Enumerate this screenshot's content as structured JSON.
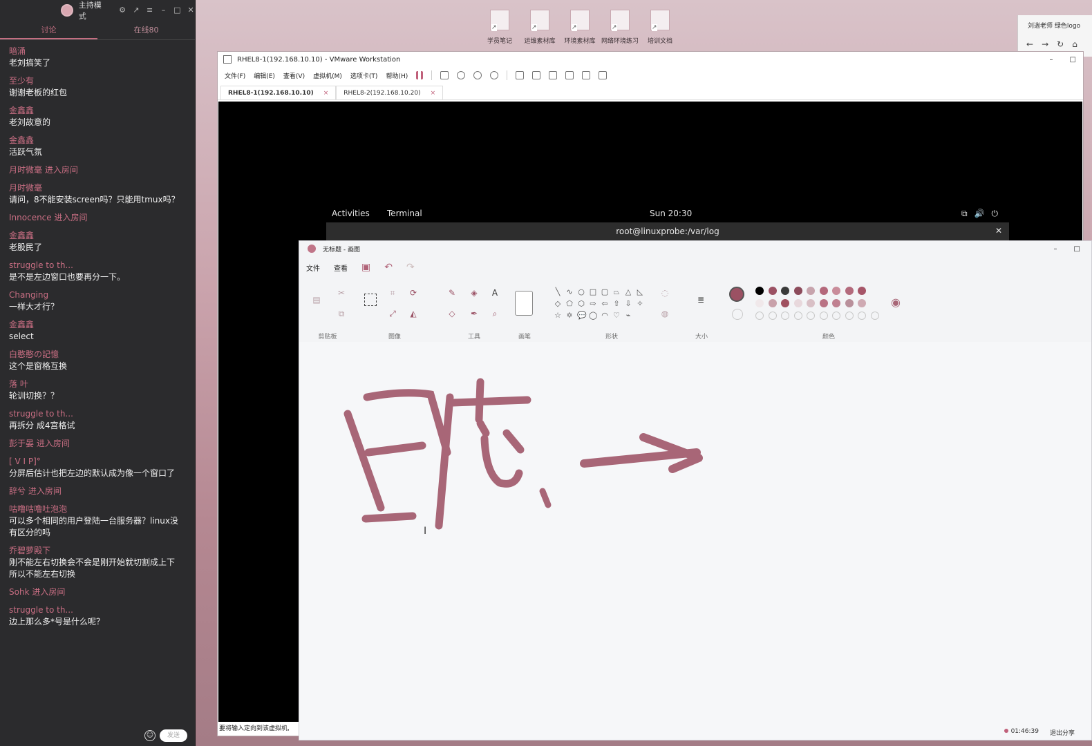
{
  "chat": {
    "mode_label": "主持模式",
    "tabs": [
      "讨论",
      "在线80"
    ],
    "messages": [
      {
        "name": "暗涌",
        "text": "老刘搞笑了"
      },
      {
        "name": "至少有",
        "text": "谢谢老板的红包"
      },
      {
        "name": "金鑫鑫",
        "text": "老刘故意的"
      },
      {
        "name": "金鑫鑫",
        "text": "活跃气氛"
      },
      {
        "name": "月时微毫 进入房间",
        "text": ""
      },
      {
        "name": "月时微毫",
        "text": "请问，8不能安装screen吗？只能用tmux吗？"
      },
      {
        "name": "Innocence 进入房间",
        "text": ""
      },
      {
        "name": "金鑫鑫",
        "text": "老股民了"
      },
      {
        "name": "struggle to th...",
        "text": "是不是左边窗口也要再分一下。"
      },
      {
        "name": "Changing",
        "text": "一样大才行？"
      },
      {
        "name": "金鑫鑫",
        "text": "select"
      },
      {
        "name": "白憨憨の記憶",
        "text": "这个是窗格互换"
      },
      {
        "name": "落  叶",
        "text": "轮训切换？？"
      },
      {
        "name": "struggle to th...",
        "text": "再拆分 成4宫格试"
      },
      {
        "name": "彭于晏 进入房间",
        "text": ""
      },
      {
        "name": "[  V  I  P]°",
        "text": "分屏后估计也把左边的默认成为像一个窗口了"
      },
      {
        "name": "辞兮 进入房间",
        "text": ""
      },
      {
        "name": "咕噜咕噜吐泡泡",
        "text": "可以多个相同的用户登陆一台服务器？linux没有区分的吗"
      },
      {
        "name": "乔碧萝殿下",
        "text": "刚不能左右切换会不会是刚开始就切割成上下 所以不能左右切换"
      },
      {
        "name": "Sohk 进入房间",
        "text": ""
      },
      {
        "name": "struggle to th...",
        "text": "边上那么多*号是什么呢？"
      }
    ],
    "send_label": "发送"
  },
  "desktop": {
    "icons": [
      "学员笔记",
      "运维素材库",
      "环境素材库",
      "网络环境练习",
      "培训文档"
    ]
  },
  "browser": {
    "tab_text": "刘遄老师 绿色logo"
  },
  "vmware": {
    "title": "RHEL8-1(192.168.10.10) - VMware Workstation",
    "menu": [
      "文件(F)",
      "编辑(E)",
      "查看(V)",
      "虚拟机(M)",
      "选项卡(T)",
      "帮助(H)"
    ],
    "tabs": [
      {
        "label": "RHEL8-1(192.168.10.10)",
        "active": true
      },
      {
        "label": "RHEL8-2(192.168.10.20)",
        "active": false
      }
    ],
    "status_text": "要将输入定向到该虚拟机,"
  },
  "gnome": {
    "activities": "Activities",
    "app": "Terminal",
    "clock": "Sun 20:30"
  },
  "terminal": {
    "title": "root@linuxprobe:/var/log"
  },
  "paint": {
    "title": "无标题 - 画图",
    "menu": [
      "文件",
      "查看"
    ],
    "groups": [
      "剪贴板",
      "图像",
      "工具",
      "画笔",
      "形状",
      "大小",
      "颜色"
    ],
    "colors": {
      "primary": "#9b5163",
      "palette_row1": [
        "#000000",
        "#9b5163",
        "#3a3a3a",
        "#8c4b5b",
        "#c7a4ad",
        "#b4687b",
        "#c98c9a",
        "#b36a7c",
        "#a65568"
      ],
      "palette_row2": [
        "#f0e8ea",
        "#c9a1aa",
        "#a0505f",
        "#e8d8dc",
        "#d9c0c6",
        "#ba7385",
        "#c08090",
        "#b9909b",
        "#cfaab3"
      ]
    },
    "drawing_color": "#a86677",
    "status": {
      "time": "01:46:39",
      "share": "退出分享"
    }
  }
}
